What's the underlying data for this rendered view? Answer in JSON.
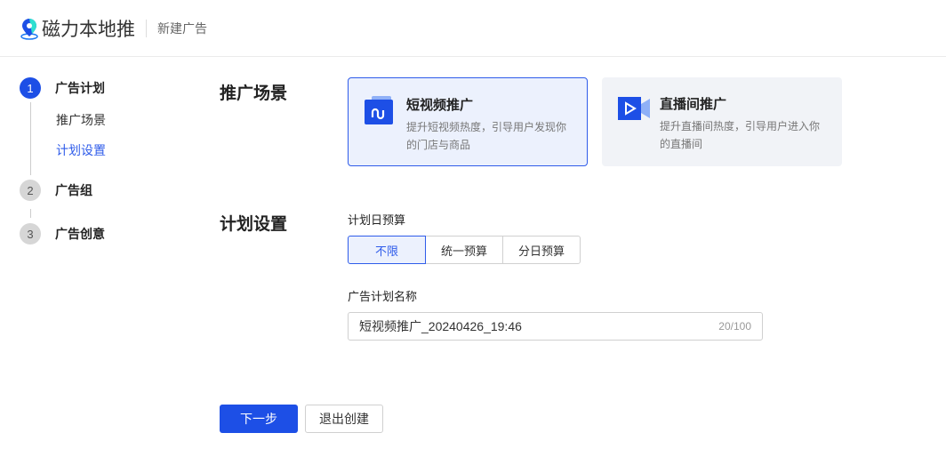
{
  "header": {
    "app_name": "磁力本地推",
    "page": "新建广告"
  },
  "steps": [
    {
      "num": "1",
      "label": "广告计划",
      "sub": [
        "推广场景",
        "计划设置"
      ]
    },
    {
      "num": "2",
      "label": "广告组"
    },
    {
      "num": "3",
      "label": "广告创意"
    }
  ],
  "scene": {
    "title": "推广场景",
    "cards": [
      {
        "title": "短视频推广",
        "desc": "提升短视频热度，引导用户发现你的门店与商品"
      },
      {
        "title": "直播间推广",
        "desc": "提升直播间热度，引导用户进入你的直播间"
      }
    ]
  },
  "plan": {
    "title": "计划设置",
    "budget_label": "计划日预算",
    "budget_options": [
      "不限",
      "统一预算",
      "分日预算"
    ],
    "name_label": "广告计划名称",
    "name_value": "短视频推广_20240426_19:46",
    "name_count": "20/100"
  },
  "actions": {
    "next": "下一步",
    "exit": "退出创建"
  },
  "colors": {
    "accent": "#1d4fe6"
  }
}
